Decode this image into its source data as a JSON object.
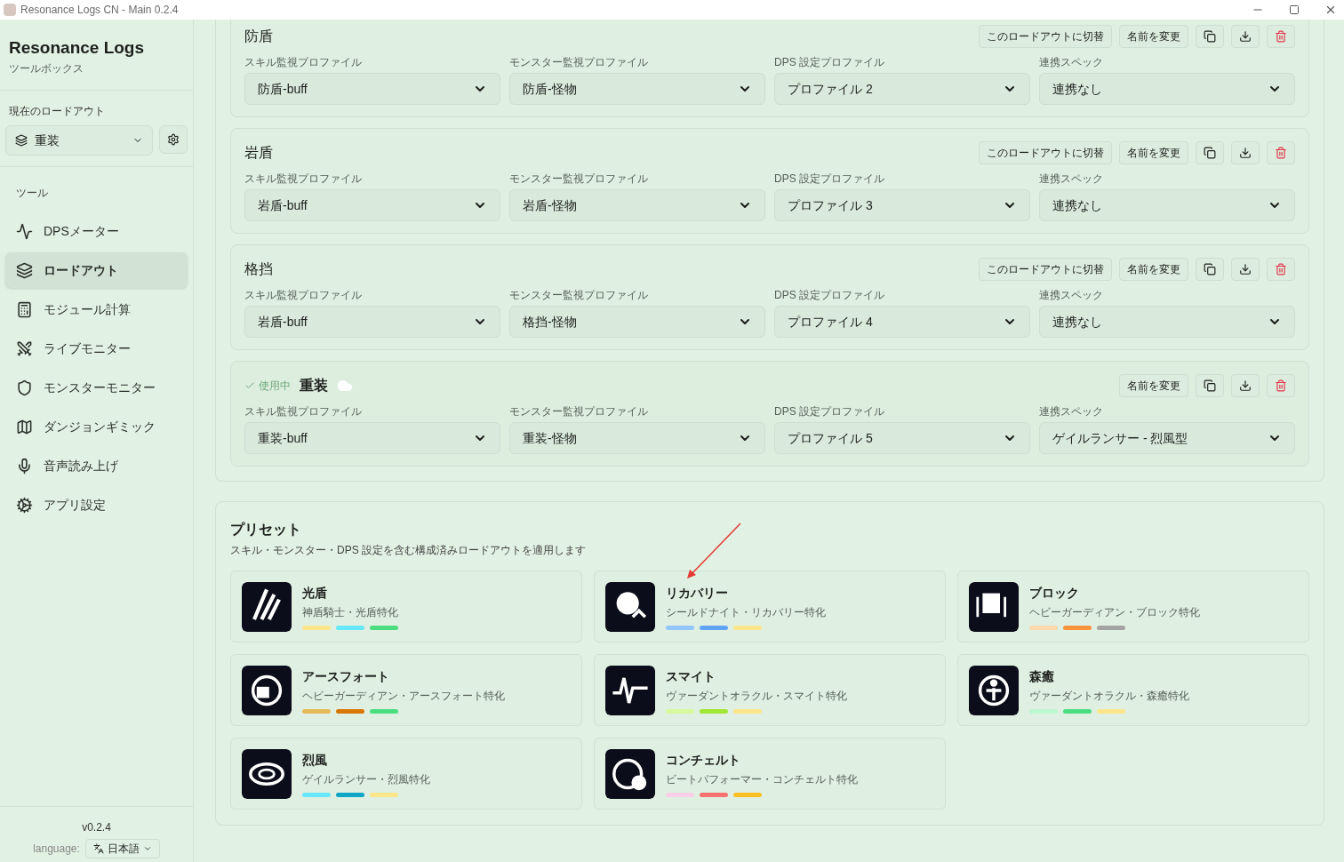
{
  "window": {
    "title": "Resonance Logs CN - Main 0.2.4"
  },
  "sidebar": {
    "app_name": "Resonance Logs",
    "app_subtitle": "ツールボックス",
    "current_loadout_label": "現在のロードアウト",
    "current_loadout": "重装",
    "tools_label": "ツール",
    "items": [
      {
        "label": "DPSメーター",
        "selected": false
      },
      {
        "label": "ロードアウト",
        "selected": true
      },
      {
        "label": "モジュール計算",
        "selected": false
      },
      {
        "label": "ライブモニター",
        "selected": false
      },
      {
        "label": "モンスターモニター",
        "selected": false
      },
      {
        "label": "ダンジョンギミック",
        "selected": false
      },
      {
        "label": "音声読み上げ",
        "selected": false
      },
      {
        "label": "アプリ設定",
        "selected": false
      }
    ],
    "version": "v0.2.4",
    "language_label": "language:",
    "language": "日本語"
  },
  "loadouts": [
    {
      "name": "防盾",
      "active": false,
      "switch_button": "このロードアウトに切替",
      "rename_button": "名前を変更",
      "fields": [
        {
          "label": "スキル監視プロファイル",
          "value": "防盾-buff"
        },
        {
          "label": "モンスター監視プロファイル",
          "value": "防盾-怪物"
        },
        {
          "label": "DPS 設定プロファイル",
          "value": "プロファイル 2"
        },
        {
          "label": "連携スペック",
          "value": "連携なし"
        }
      ]
    },
    {
      "name": "岩盾",
      "active": false,
      "switch_button": "このロードアウトに切替",
      "rename_button": "名前を変更",
      "fields": [
        {
          "label": "スキル監視プロファイル",
          "value": "岩盾-buff"
        },
        {
          "label": "モンスター監視プロファイル",
          "value": "岩盾-怪物"
        },
        {
          "label": "DPS 設定プロファイル",
          "value": "プロファイル 3"
        },
        {
          "label": "連携スペック",
          "value": "連携なし"
        }
      ]
    },
    {
      "name": "格挡",
      "active": false,
      "switch_button": "このロードアウトに切替",
      "rename_button": "名前を変更",
      "fields": [
        {
          "label": "スキル監視プロファイル",
          "value": "岩盾-buff"
        },
        {
          "label": "モンスター監視プロファイル",
          "value": "格挡-怪物"
        },
        {
          "label": "DPS 設定プロファイル",
          "value": "プロファイル 4"
        },
        {
          "label": "連携スペック",
          "value": "連携なし"
        }
      ]
    },
    {
      "name": "重装",
      "active": true,
      "active_label": "使用中",
      "rename_button": "名前を変更",
      "fields": [
        {
          "label": "スキル監視プロファイル",
          "value": "重装-buff"
        },
        {
          "label": "モンスター監視プロファイル",
          "value": "重装-怪物"
        },
        {
          "label": "DPS 設定プロファイル",
          "value": "プロファイル 5"
        },
        {
          "label": "連携スペック",
          "value": "ゲイルランサー - 烈風型"
        }
      ]
    }
  ],
  "presets": {
    "title": "プリセット",
    "subtitle": "スキル・モンスター・DPS 設定を含む構成済みロードアウトを適用します",
    "items": [
      {
        "name": "光盾",
        "description": "神盾騎士・光盾特化",
        "tags": [
          {
            "color": "#fde68a"
          },
          {
            "color": "#67e8f9"
          },
          {
            "color": "#4ade80"
          }
        ]
      },
      {
        "name": "リカバリー",
        "description": "シールドナイト・リカバリー特化",
        "tags": [
          {
            "color": "#93c5fd"
          },
          {
            "color": "#60a5fa"
          },
          {
            "color": "#fde68a"
          }
        ]
      },
      {
        "name": "ブロック",
        "description": "ヘビーガーディアン・ブロック特化",
        "tags": [
          {
            "color": "#fed7aa"
          },
          {
            "color": "#fb923c"
          },
          {
            "color": "#a3a3a3"
          }
        ]
      },
      {
        "name": "アースフォート",
        "description": "ヘビーガーディアン・アースフォート特化",
        "tags": [
          {
            "color": "#e5b95a"
          },
          {
            "color": "#d97706"
          },
          {
            "color": "#4ade80"
          }
        ]
      },
      {
        "name": "スマイト",
        "description": "ヴァーダントオラクル・スマイト特化",
        "tags": [
          {
            "color": "#d9f99d"
          },
          {
            "color": "#a3e635"
          },
          {
            "color": "#fde68a"
          }
        ]
      },
      {
        "name": "森癒",
        "description": "ヴァーダントオラクル・森癒特化",
        "tags": [
          {
            "color": "#bbf7d0"
          },
          {
            "color": "#4ade80"
          },
          {
            "color": "#fde68a"
          }
        ]
      },
      {
        "name": "烈風",
        "description": "ゲイルランサー・烈風特化",
        "tags": [
          {
            "color": "#67e8f9"
          },
          {
            "color": "#0ea5c6"
          },
          {
            "color": "#fde68a"
          }
        ]
      },
      {
        "name": "コンチェルト",
        "description": "ビートパフォーマー・コンチェルト特化",
        "tags": [
          {
            "color": "#fbcfe8"
          },
          {
            "color": "#f87171"
          },
          {
            "color": "#fbbf24"
          }
        ]
      }
    ]
  }
}
